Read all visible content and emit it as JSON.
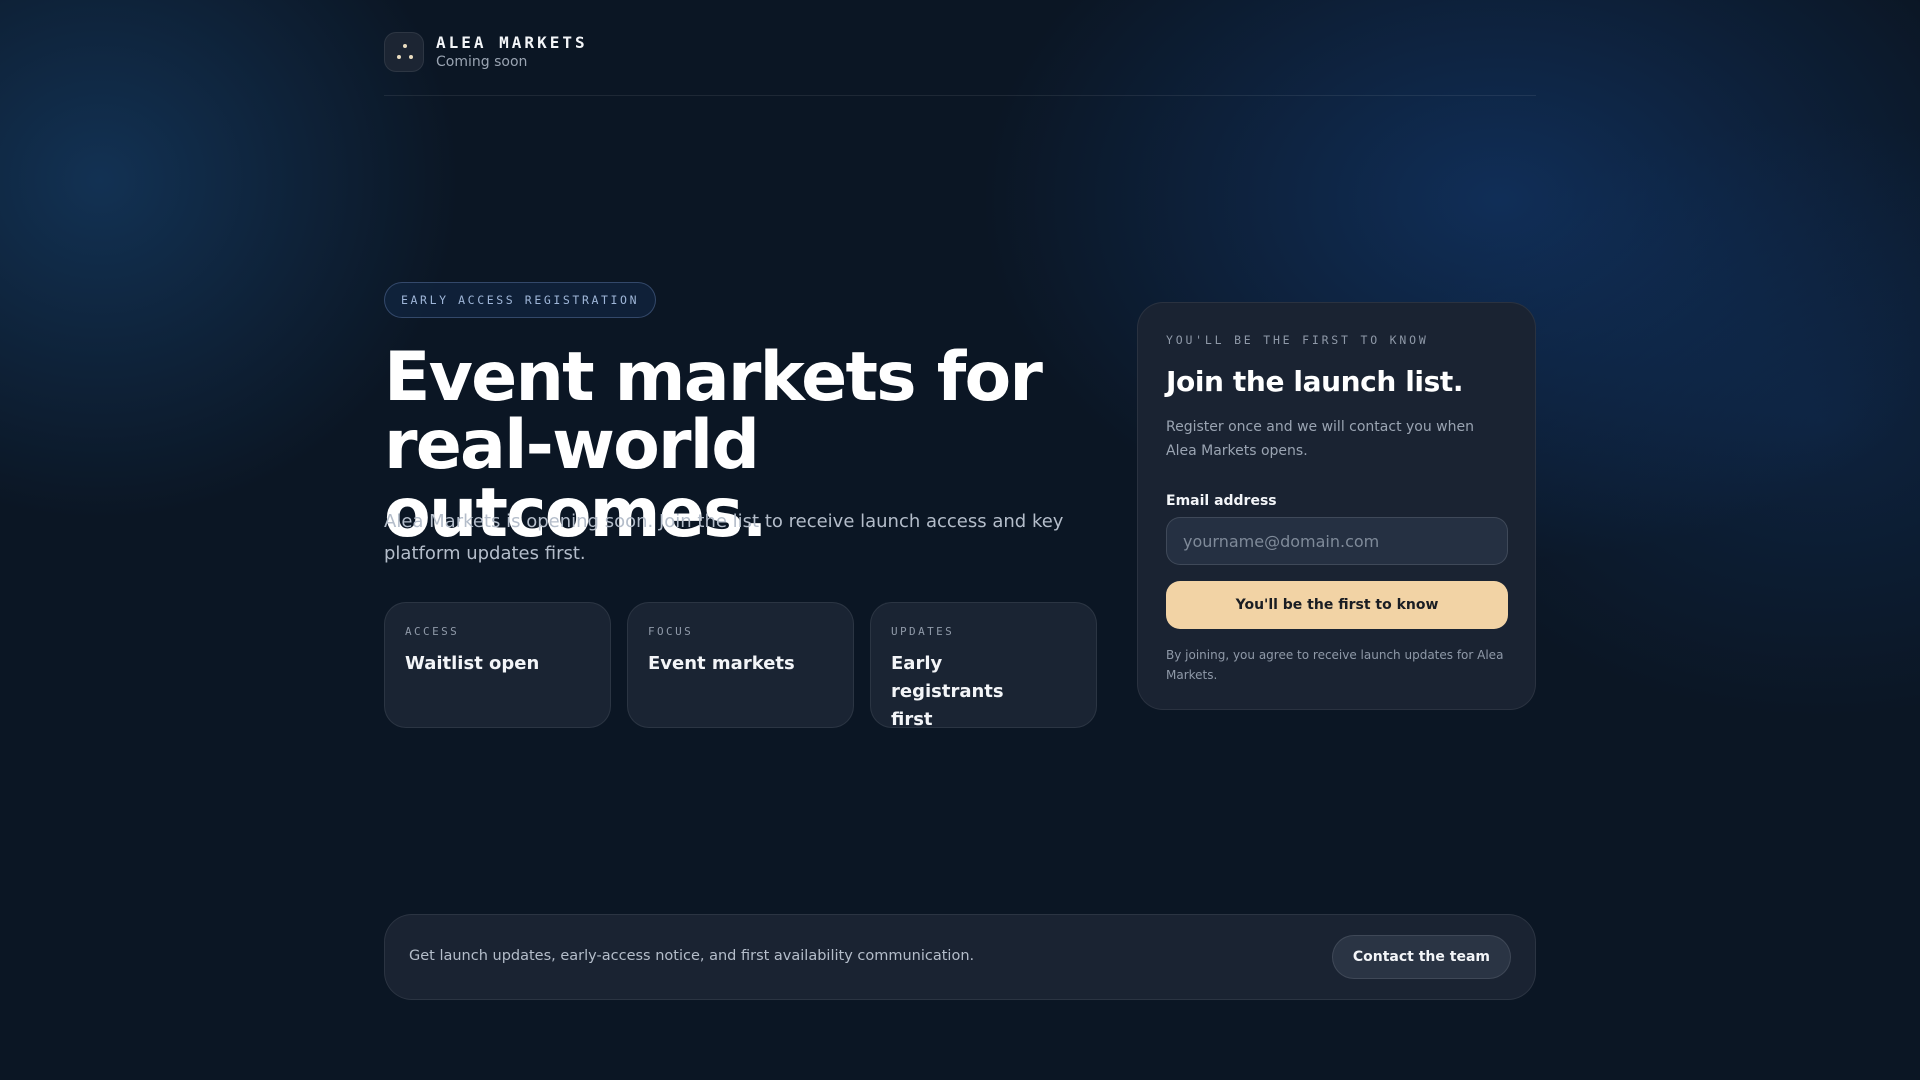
{
  "header": {
    "brand": "ALEA MARKETS",
    "subtitle": "Coming soon",
    "logo_icon": "three-dot-logo-icon"
  },
  "hero": {
    "badge": "EARLY ACCESS REGISTRATION",
    "title": "Event markets for real-world outcomes.",
    "description": "Alea Markets is opening soon. Join the list to receive launch access and key platform updates first.",
    "features": [
      {
        "label": "ACCESS",
        "value": "Waitlist open"
      },
      {
        "label": "FOCUS",
        "value": "Event markets"
      },
      {
        "label": "UPDATES",
        "value": "Early registrants first"
      }
    ]
  },
  "signup": {
    "eyebrow": "YOU'LL BE THE FIRST TO KNOW",
    "title": "Join the launch list.",
    "description": "Register once and we will contact you when Alea Markets opens.",
    "email_label": "Email address",
    "email_placeholder": "yourname@domain.com",
    "email_value": "",
    "submit_label": "You'll be the first to know",
    "fine_print": "By joining, you agree to receive launch updates for Alea Markets."
  },
  "footer": {
    "message": "Get launch updates, early-access notice, and first availability communication.",
    "contact_label": "Contact the team"
  },
  "colors": {
    "background": "#0b1624",
    "card": "#1a2332",
    "accent_button": "#f2d3a5",
    "badge_text": "#9fb6d8"
  }
}
